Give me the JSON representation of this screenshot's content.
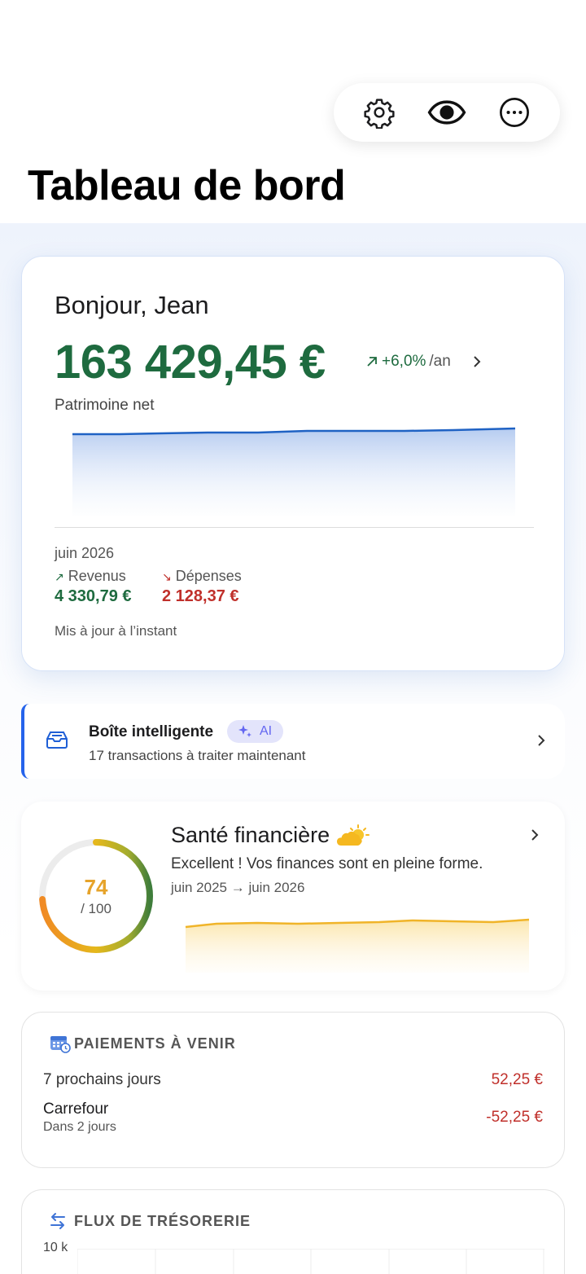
{
  "header": {
    "title": "Tableau de bord",
    "toolbar": [
      "gear-icon",
      "eye-icon",
      "more-icon"
    ]
  },
  "net_worth": {
    "greeting": "Bonjour, Jean",
    "amount": "163 429,45 €",
    "change": "+6,0%",
    "change_period": "/an",
    "label": "Patrimoine net",
    "month": "juin 2026",
    "income_label": "Revenus",
    "income_value": "4 330,79 €",
    "expenses_label": "Dépenses",
    "expenses_value": "2 128,37 €",
    "updated": "Mis à jour à l’instant",
    "positive_color": "#1e6b3f",
    "negative_color": "#c0302b"
  },
  "smart_inbox": {
    "title": "Boîte intelligente",
    "badge": "AI",
    "subtitle": "17 transactions à traiter maintenant",
    "accent": "#2563eb"
  },
  "health": {
    "title": "Santé financière",
    "weather_icon": "sun-cloud-icon",
    "score": "74",
    "score_max": "/ 100",
    "score_fraction": 0.74,
    "message": "Excellent ! Vos finances sont en pleine forme.",
    "period": "juin 2025 → juin 2026"
  },
  "upcoming": {
    "title": "PAIEMENTS À VENIR",
    "summary_label": "7 prochains jours",
    "summary_value": "52,25 €",
    "items": [
      {
        "name": "Carrefour",
        "when": "Dans 2 jours",
        "amount": "-52,25 €"
      }
    ]
  },
  "cash_flow": {
    "title": "FLUX DE TRÉSORERIE",
    "y_tick": "10 k"
  }
}
